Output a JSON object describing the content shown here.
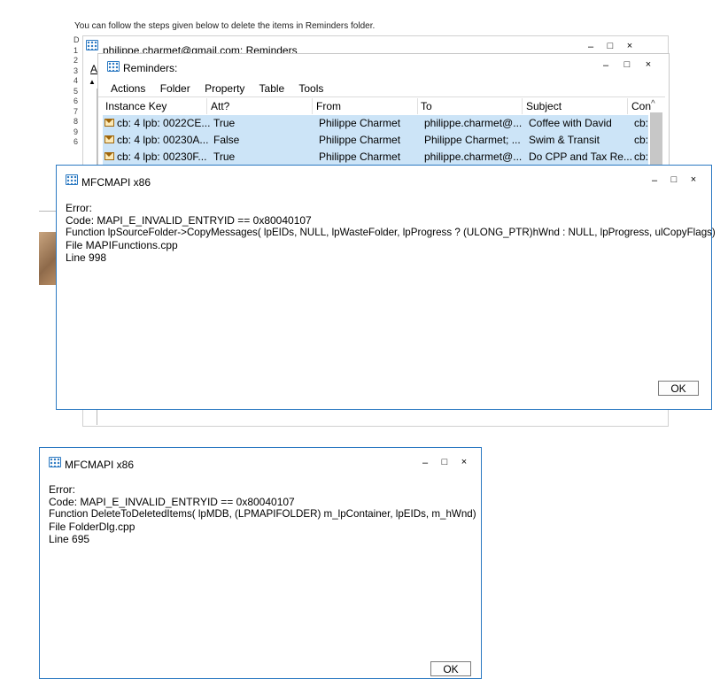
{
  "instruction": "You can follow the steps given below to delete the items in Reminders folder.",
  "gutter_numbers": [
    "D",
    "1",
    "2",
    "3",
    "4",
    "5",
    "6",
    "7",
    "8",
    "9",
    "6"
  ],
  "bg_window": {
    "title": "philippe.charmet@gmail.com: Reminders",
    "side_letter": "A",
    "controls": {
      "min": "–",
      "max": "□",
      "close": "×"
    }
  },
  "reminders_window": {
    "title": "Reminders:",
    "controls": {
      "min": "–",
      "max": "□",
      "close": "×"
    },
    "menu": [
      "Actions",
      "Folder",
      "Property",
      "Table",
      "Tools"
    ],
    "columns": [
      "Instance Key",
      "Att?",
      "From",
      "To",
      "Subject",
      "Con"
    ],
    "rows": [
      [
        "cb: 4 lpb: 0022CE...",
        "True",
        "Philippe Charmet",
        "philippe.charmet@...",
        "Coffee with David",
        "cb:"
      ],
      [
        "cb: 4 lpb: 00230A...",
        "False",
        "Philippe Charmet",
        "Philippe Charmet; ...",
        "Swim & Transit",
        "cb:"
      ],
      [
        "cb: 4 lpb: 00230F...",
        "True",
        "Philippe Charmet",
        "philippe.charmet@...",
        "Do CPP and Tax Re...",
        "cb:"
      ]
    ]
  },
  "error_dialog_1": {
    "title": "MFCMAPI x86",
    "controls": {
      "min": "–",
      "max": "□",
      "close": "×"
    },
    "lines": [
      "Error:",
      "Code: MAPI_E_INVALID_ENTRYID == 0x80040107",
      "Function lpSourceFolder->CopyMessages( lpEIDs, NULL, lpWasteFolder, lpProgress ? (ULONG_PTR)hWnd : NULL, lpProgress, ulCopyFlags)",
      "File MAPIFunctions.cpp",
      "Line 998"
    ],
    "ok_label": "OK"
  },
  "error_dialog_2": {
    "title": "MFCMAPI x86",
    "controls": {
      "min": "–",
      "max": "□",
      "close": "×"
    },
    "lines": [
      "Error:",
      "Code: MAPI_E_INVALID_ENTRYID == 0x80040107",
      "Function DeleteToDeletedItems( lpMDB, (LPMAPIFOLDER) m_lpContainer, lpEIDs, m_hWnd)",
      "File FolderDlg.cpp",
      "Line 695"
    ],
    "ok_label": "OK"
  },
  "colors": {
    "accent": "#2b79c2",
    "row_selected": "#cce4f7",
    "border": "#b8b8b8"
  }
}
